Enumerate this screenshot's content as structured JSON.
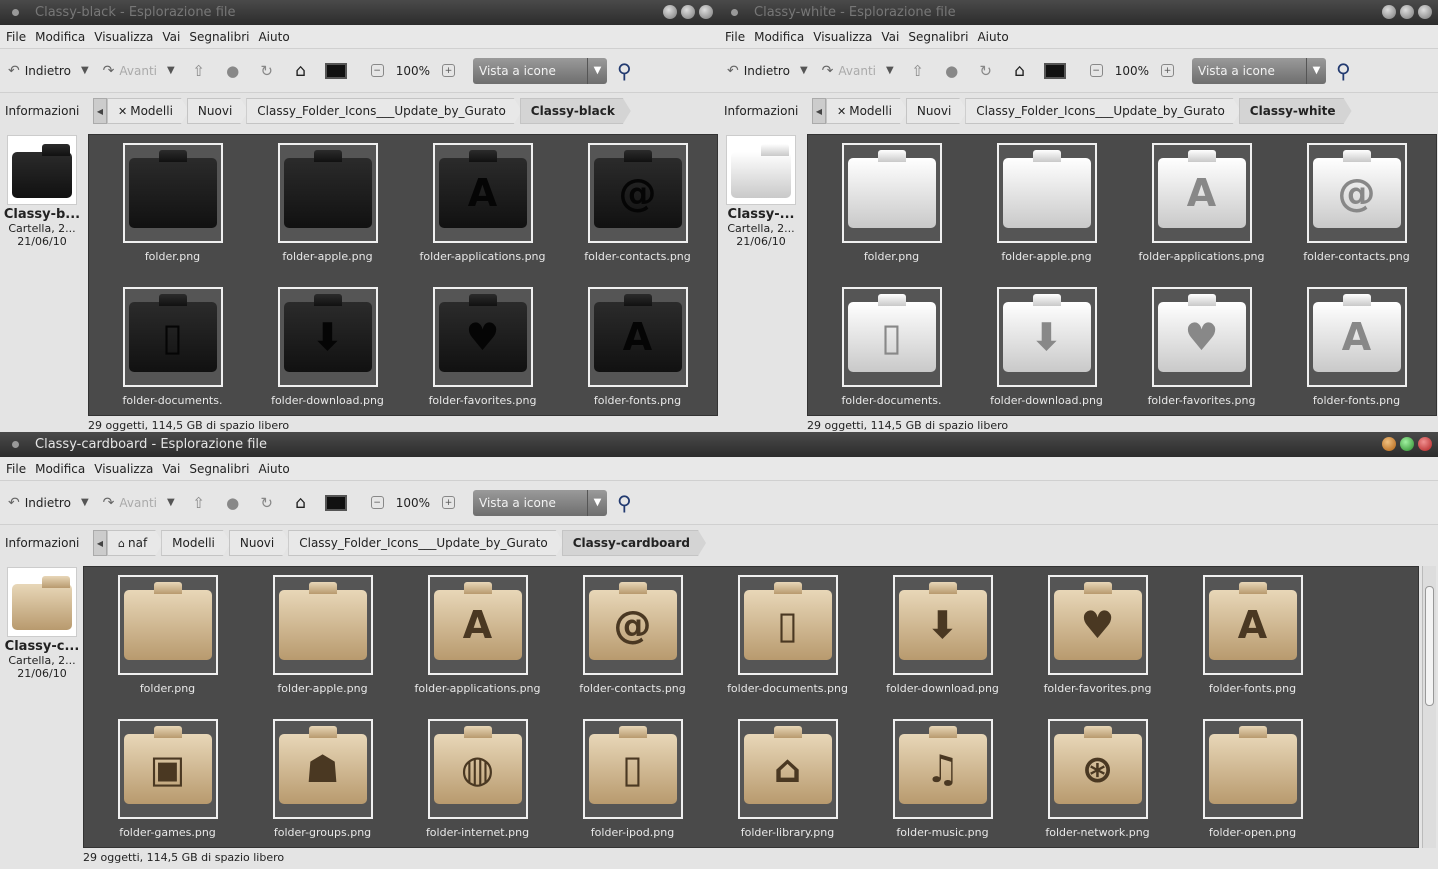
{
  "windows": [
    {
      "title": "Classy-black - Esplorazione file",
      "theme": "black",
      "menu": [
        "File",
        "Modifica",
        "Visualizza",
        "Vai",
        "Segnalibri",
        "Aiuto"
      ],
      "toolbar": {
        "back": "Indietro",
        "forward": "Avanti",
        "zoom": "100%",
        "view": "Vista a icone"
      },
      "path": {
        "info": "Informazioni",
        "crumbs": [
          "Modelli",
          "Nuovi",
          "Classy_Folder_Icons___Update_by_Gurato",
          "Classy-black"
        ]
      },
      "sidebar": {
        "name": "Classy-b...",
        "type": "Cartella, 2...",
        "date": "21/06/10"
      },
      "items": [
        {
          "name": "folder.png",
          "glyph": ""
        },
        {
          "name": "folder-apple.png",
          "glyph": ""
        },
        {
          "name": "folder-applications.png",
          "glyph": "A"
        },
        {
          "name": "folder-contacts.png",
          "glyph": "@"
        },
        {
          "name": "folder-documents.",
          "glyph": "▯"
        },
        {
          "name": "folder-download.png",
          "glyph": "⬇"
        },
        {
          "name": "folder-favorites.png",
          "glyph": "♥"
        },
        {
          "name": "folder-fonts.png",
          "glyph": "A"
        }
      ],
      "status": "29 oggetti, 114,5 GB di spazio libero"
    },
    {
      "title": "Classy-white - Esplorazione file",
      "theme": "white",
      "menu": [
        "File",
        "Modifica",
        "Visualizza",
        "Vai",
        "Segnalibri",
        "Aiuto"
      ],
      "toolbar": {
        "back": "Indietro",
        "forward": "Avanti",
        "zoom": "100%",
        "view": "Vista a icone"
      },
      "path": {
        "info": "Informazioni",
        "crumbs": [
          "Modelli",
          "Nuovi",
          "Classy_Folder_Icons___Update_by_Gurato",
          "Classy-white"
        ]
      },
      "sidebar": {
        "name": "Classy-...",
        "type": "Cartella, 2...",
        "date": "21/06/10"
      },
      "items": [
        {
          "name": "folder.png",
          "glyph": ""
        },
        {
          "name": "folder-apple.png",
          "glyph": ""
        },
        {
          "name": "folder-applications.png",
          "glyph": "A"
        },
        {
          "name": "folder-contacts.png",
          "glyph": "@"
        },
        {
          "name": "folder-documents.",
          "glyph": "▯"
        },
        {
          "name": "folder-download.png",
          "glyph": "⬇"
        },
        {
          "name": "folder-favorites.png",
          "glyph": "♥"
        },
        {
          "name": "folder-fonts.png",
          "glyph": "A"
        }
      ],
      "status": "29 oggetti, 114,5 GB di spazio libero"
    },
    {
      "title": "Classy-cardboard - Esplorazione file",
      "theme": "card",
      "menu": [
        "File",
        "Modifica",
        "Visualizza",
        "Vai",
        "Segnalibri",
        "Aiuto"
      ],
      "toolbar": {
        "back": "Indietro",
        "forward": "Avanti",
        "zoom": "100%",
        "view": "Vista a icone"
      },
      "path": {
        "info": "Informazioni",
        "crumbs": [
          "naf",
          "Modelli",
          "Nuovi",
          "Classy_Folder_Icons___Update_by_Gurato",
          "Classy-cardboard"
        ]
      },
      "sidebar": {
        "name": "Classy-c...",
        "type": "Cartella, 2...",
        "date": "21/06/10"
      },
      "items": [
        {
          "name": "folder.png",
          "glyph": ""
        },
        {
          "name": "folder-apple.png",
          "glyph": ""
        },
        {
          "name": "folder-applications.png",
          "glyph": "A"
        },
        {
          "name": "folder-contacts.png",
          "glyph": "@"
        },
        {
          "name": "folder-documents.png",
          "glyph": "▯"
        },
        {
          "name": "folder-download.png",
          "glyph": "⬇"
        },
        {
          "name": "folder-favorites.png",
          "glyph": "♥"
        },
        {
          "name": "folder-fonts.png",
          "glyph": "A"
        },
        {
          "name": "folder-games.png",
          "glyph": "▣"
        },
        {
          "name": "folder-groups.png",
          "glyph": "☗"
        },
        {
          "name": "folder-internet.png",
          "glyph": "◍"
        },
        {
          "name": "folder-ipod.png",
          "glyph": "▯"
        },
        {
          "name": "folder-library.png",
          "glyph": "⌂"
        },
        {
          "name": "folder-music.png",
          "glyph": "♫"
        },
        {
          "name": "folder-network.png",
          "glyph": "⊛"
        },
        {
          "name": "folder-open.png",
          "glyph": ""
        }
      ],
      "status": "29 oggetti, 114,5 GB di spazio libero"
    }
  ]
}
